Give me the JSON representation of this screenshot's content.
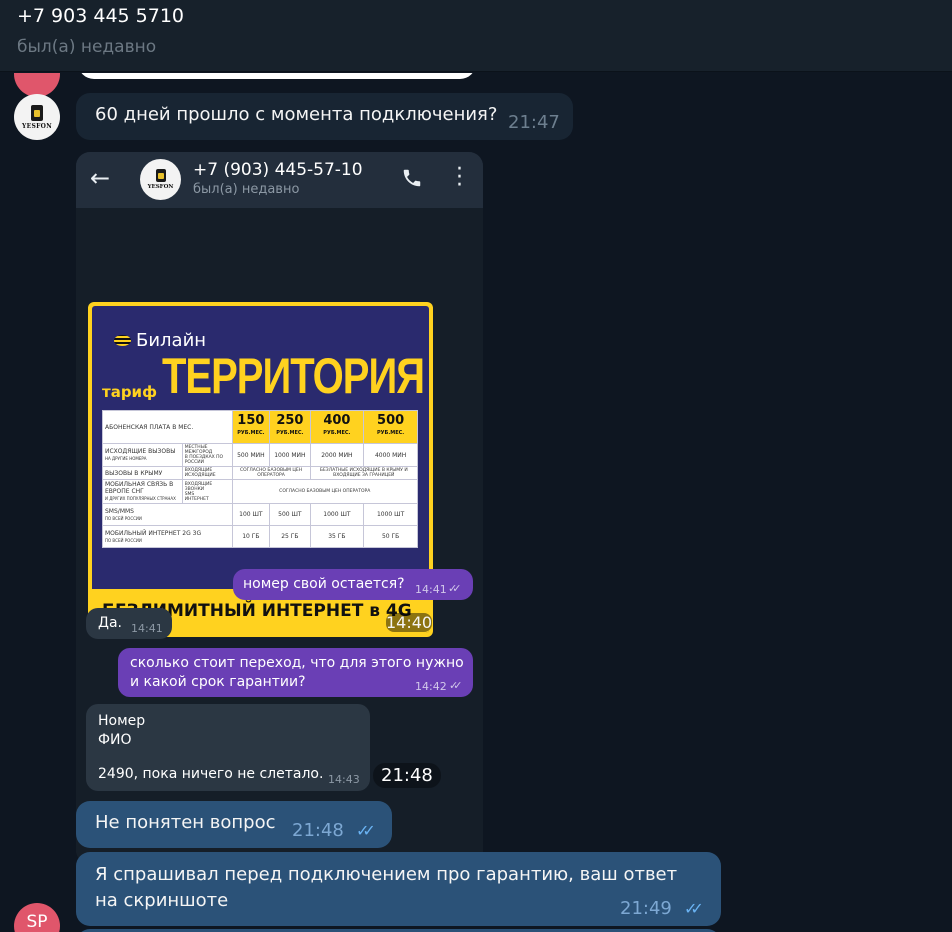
{
  "header": {
    "title": "+7 903 445 5710",
    "status": "был(а) недавно"
  },
  "avatars": {
    "contact_brand": "YESFON",
    "user_initials": "SP"
  },
  "messages": [
    {
      "text": "60 дней прошло с момента подключения?",
      "time": "21:47"
    },
    {
      "text": "Не понятен вопрос",
      "time": "21:48"
    },
    {
      "text": "Я спрашивал перед подключением про гарантию, ваш ответ на скриншоте",
      "time": "21:49"
    }
  ],
  "screenshot": {
    "time": "21:48",
    "phone_title": "+7 (903) 445-57-10",
    "phone_status": "был(а) недавно",
    "promo": {
      "brand": "Билайн",
      "tarif_label": "тариф",
      "tarif_name": "ТЕРРИТОРИЯ",
      "fee_label": "АБОНЕНСКАЯ ПЛАТА В МЕС.",
      "prices": [
        "150",
        "250",
        "400",
        "500"
      ],
      "price_unit": "РУБ.МЕС.",
      "row_outgoing": "ИСХОДЯЩИЕ ВЫЗОВЫ",
      "row_outgoing_sub": "НА ДРУГИЕ НОМЕРА",
      "sub_local": "МЕСТНЫЕ",
      "sub_intercity": "МЕЖГОРОД",
      "sub_travel": "В ПОЕЗДКАХ ПО РОССИИ",
      "minutes": [
        "500 МИН",
        "1000 МИН",
        "2000 МИН",
        "4000 МИН"
      ],
      "row_crimea": "ВЫЗОВЫ В КРЫМУ",
      "sub_incoming": "ВХОДЯЩИЕ",
      "sub_outgoing": "ИСХОДЯЩИЕ",
      "note_base": "СОГЛАСНО БАЗОВЫМ ЦЕН ОПЕРАТОРА",
      "note_crimea": "БЕЗЛАТНЫЕ ИСХОДЯЩИЕ В КРЫМУ И ВХОДЯЩИЕ ЗА ГРАНИЦЕЙ",
      "row_cis": "МОБИЛЬНАЯ СВЯЗЬ В ЕВРОПЕ СНГ",
      "row_cis_sub": "И ДРУГИХ ПОПУЛЯРНЫХ СТРАНАХ",
      "sub_incoming_calls": "ВХОДЯЩИЕ ЗВОНКИ",
      "sub_sms": "SMS",
      "sub_internet": "ИНТЕРНЕТ",
      "row_sms": "SMS/MMS",
      "row_sms_sub": "ПО ВСЕЙ РОССИИ",
      "sms": [
        "100 ШТ",
        "500 ШТ",
        "1000 ШТ",
        "1000 ШТ"
      ],
      "row_internet": "МОБИЛЬНЫЙ ИНТЕРНЕТ 2G 3G",
      "row_internet_sub": "ПО ВСЕЙ РОССИИ",
      "gb": [
        "10 ГБ",
        "25 ГБ",
        "35 ГБ",
        "50 ГБ"
      ],
      "banner": "БЕЗЛИМИТНЫЙ ИНТЕРНЕТ в 4G",
      "time": "14:40"
    },
    "messages": [
      {
        "text": "номер свой остается?",
        "time": "14:41"
      },
      {
        "text": "Да.",
        "time": "14:41"
      },
      {
        "text": "сколько стоит переход, что для этого нужно и какой срок гарантии?",
        "time": "14:42"
      },
      {
        "line1": "Номер",
        "line2": "ФИО",
        "line3": "2490, пока ничего не слетало.",
        "time": "14:43"
      }
    ]
  },
  "colors": {
    "background": "#0e1621",
    "header": "#17212b",
    "incoming_bubble": "#182533",
    "outgoing_bubble": "#2b5278",
    "read_ticks": "#6ab3f3",
    "phone_outgoing": "#6a3fb5"
  }
}
